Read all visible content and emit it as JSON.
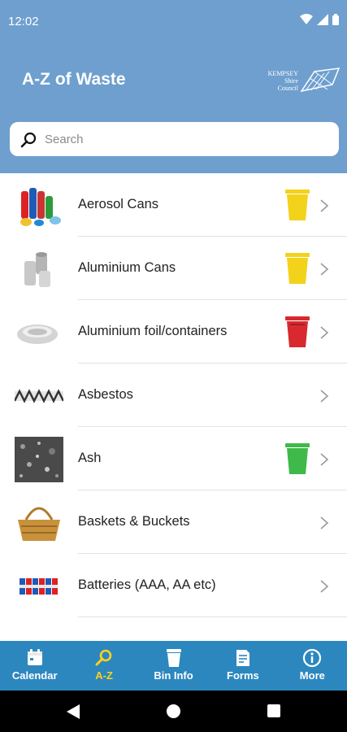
{
  "status": {
    "time": "12:02"
  },
  "header": {
    "title": "A-Z of Waste",
    "logo_line1": "KEMPSEY",
    "logo_line2": "Shire Council"
  },
  "search": {
    "placeholder": "Search",
    "value": ""
  },
  "colors": {
    "header": "#6e9fcf",
    "tabbar": "#2c87be",
    "active_tab": "#ffd21f",
    "bin_yellow": "#f3d21b",
    "bin_red": "#d8292f",
    "bin_green": "#3fb94a"
  },
  "items": [
    {
      "label": "Aerosol Cans",
      "bin": "yellow"
    },
    {
      "label": "Aluminium Cans",
      "bin": "yellow"
    },
    {
      "label": "Aluminium foil/containers",
      "bin": "red"
    },
    {
      "label": "Asbestos",
      "bin": ""
    },
    {
      "label": "Ash",
      "bin": "green"
    },
    {
      "label": "Baskets & Buckets",
      "bin": ""
    },
    {
      "label": "Batteries (AAA, AA etc)",
      "bin": ""
    },
    {
      "label": "",
      "bin": ""
    }
  ],
  "tabs": [
    {
      "label": "Calendar",
      "icon": "calendar-icon",
      "active": false
    },
    {
      "label": "A-Z",
      "icon": "search-icon",
      "active": true
    },
    {
      "label": "Bin Info",
      "icon": "bin-icon",
      "active": false
    },
    {
      "label": "Forms",
      "icon": "form-icon",
      "active": false
    },
    {
      "label": "More",
      "icon": "info-icon",
      "active": false
    }
  ]
}
